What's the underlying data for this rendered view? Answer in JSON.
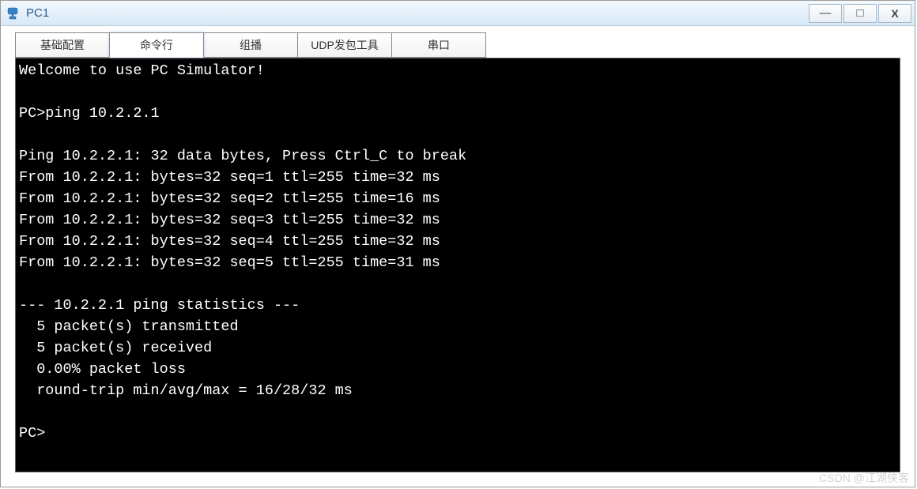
{
  "window": {
    "title": "PC1"
  },
  "controls": {
    "minimize": "—",
    "maximize": "□",
    "close": "X"
  },
  "tabs": [
    {
      "label": "基础配置",
      "active": false
    },
    {
      "label": "命令行",
      "active": true
    },
    {
      "label": "组播",
      "active": false
    },
    {
      "label": "UDP发包工具",
      "active": false
    },
    {
      "label": "串口",
      "active": false
    }
  ],
  "terminal": {
    "lines": [
      "Welcome to use PC Simulator!",
      "",
      "PC>ping 10.2.2.1",
      "",
      "Ping 10.2.2.1: 32 data bytes, Press Ctrl_C to break",
      "From 10.2.2.1: bytes=32 seq=1 ttl=255 time=32 ms",
      "From 10.2.2.1: bytes=32 seq=2 ttl=255 time=16 ms",
      "From 10.2.2.1: bytes=32 seq=3 ttl=255 time=32 ms",
      "From 10.2.2.1: bytes=32 seq=4 ttl=255 time=32 ms",
      "From 10.2.2.1: bytes=32 seq=5 ttl=255 time=31 ms",
      "",
      "--- 10.2.2.1 ping statistics ---",
      "  5 packet(s) transmitted",
      "  5 packet(s) received",
      "  0.00% packet loss",
      "  round-trip min/avg/max = 16/28/32 ms",
      "",
      "PC>"
    ]
  },
  "watermark": "CSDN @江湖侠客"
}
